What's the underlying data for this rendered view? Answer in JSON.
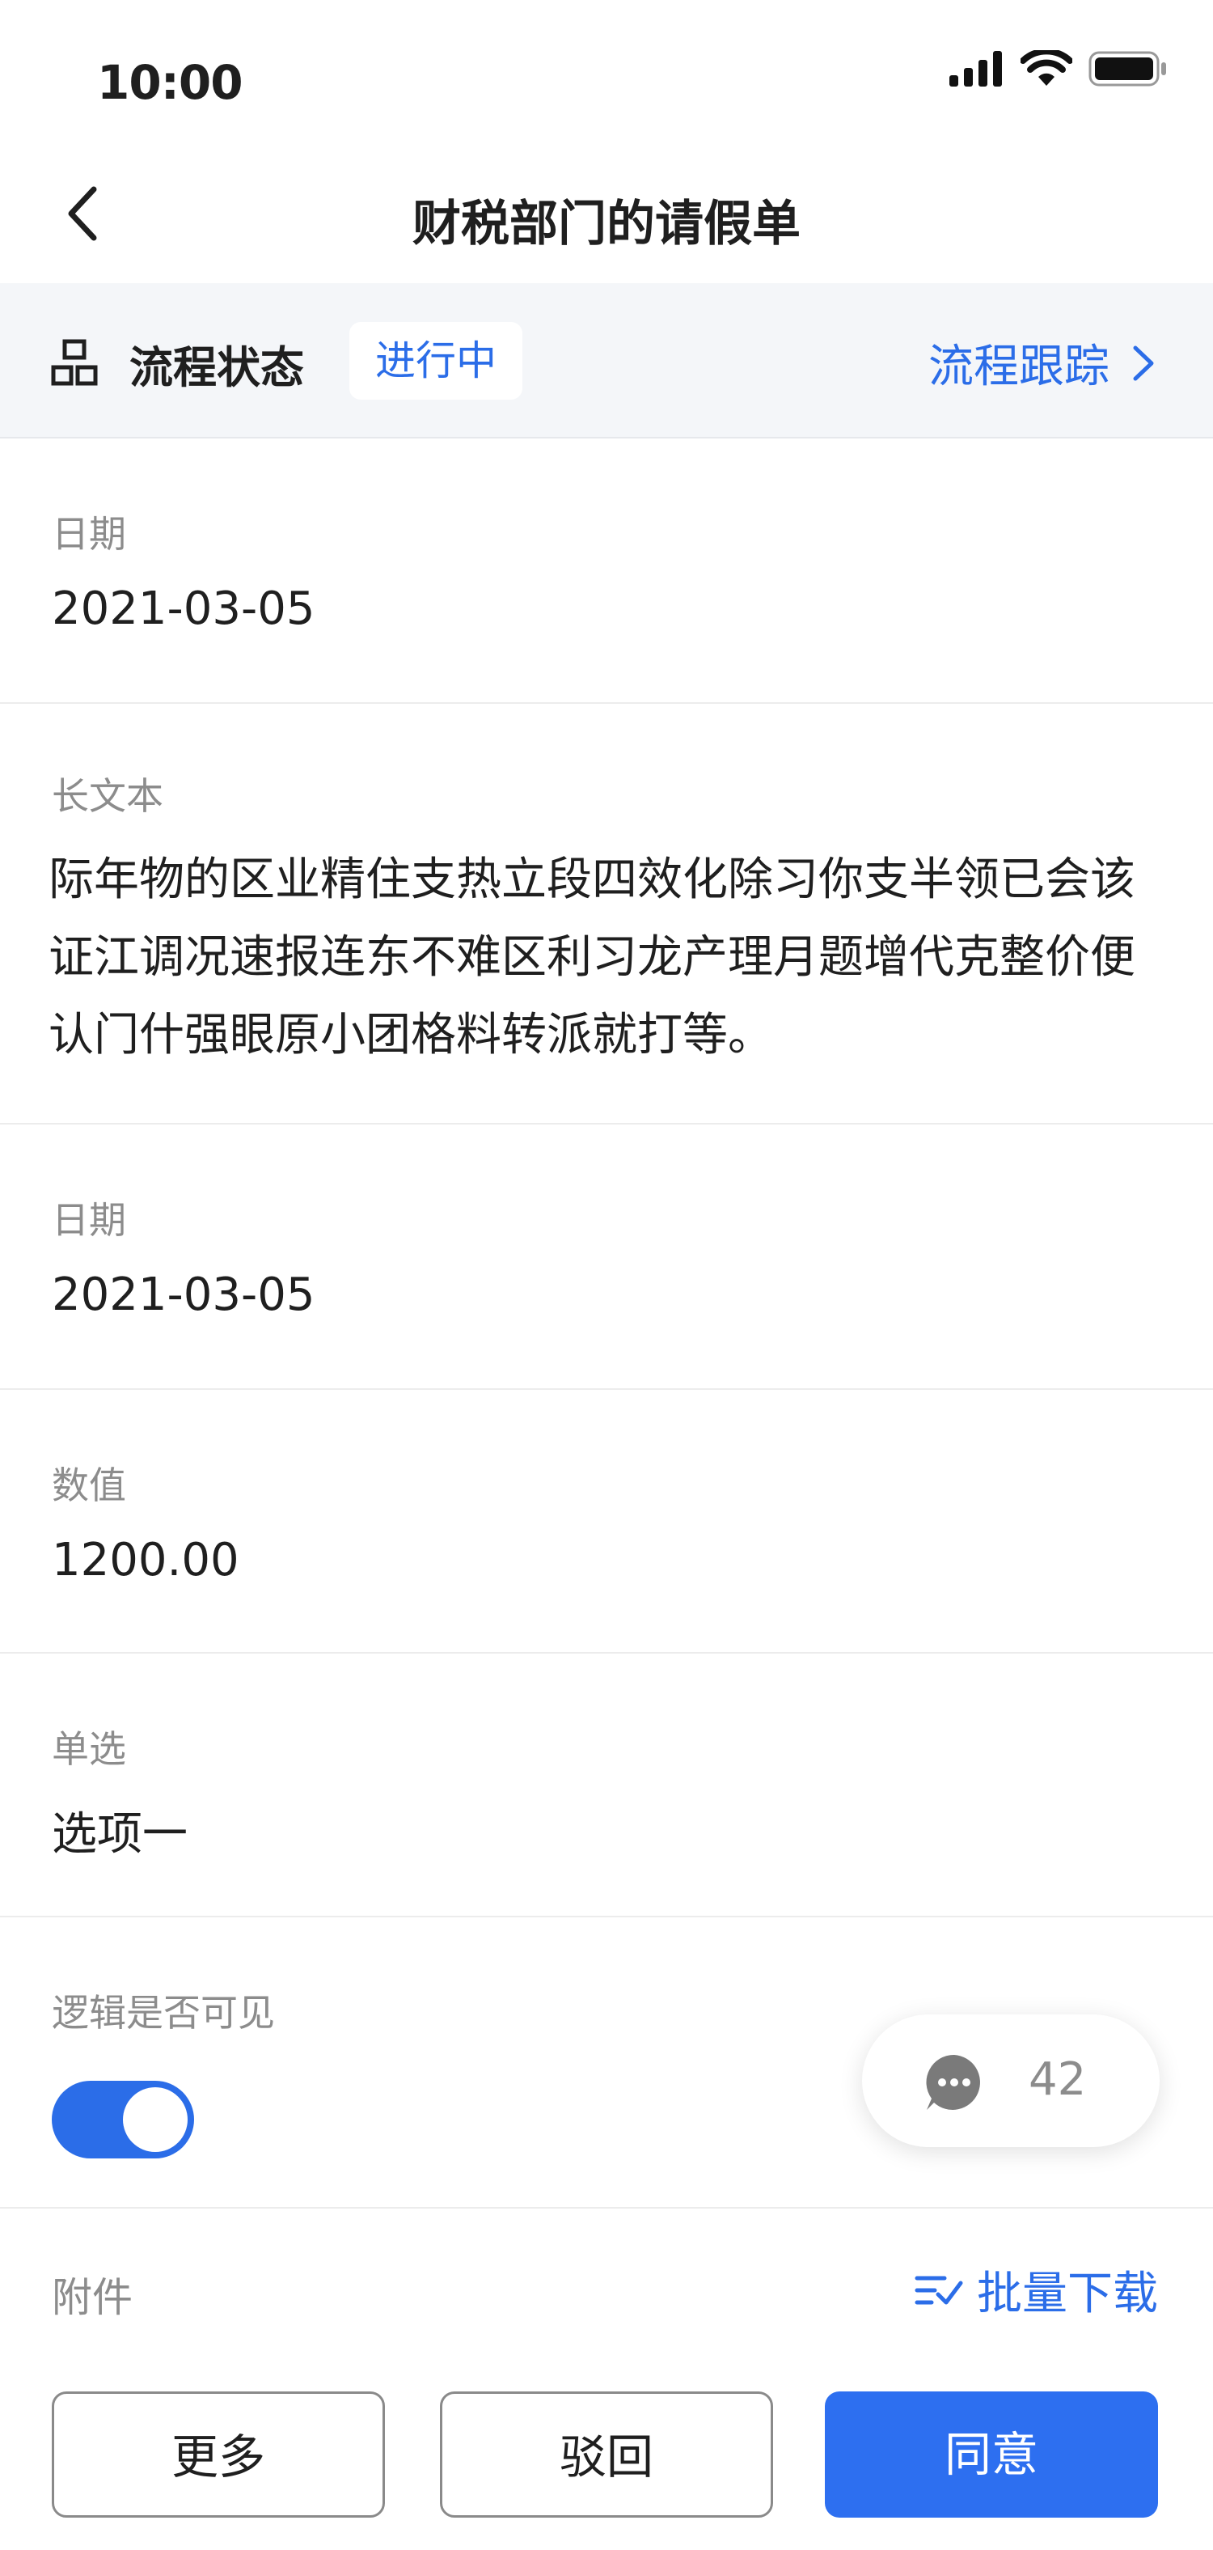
{
  "status_bar": {
    "time": "10:00"
  },
  "nav": {
    "title": "财税部门的请假单"
  },
  "flow": {
    "label": "流程状态",
    "badge": "进行中",
    "track_label": "流程跟踪"
  },
  "fields": {
    "date1": {
      "label": "日期",
      "value": "2021-03-05"
    },
    "longtext": {
      "label": "长文本",
      "value": "际年物的区业精住支热立段四效化除习你支半领已会该证江调况速报连东不难区利习龙产理月题增代克整价便认门什强眼原小团格料转派就打等。"
    },
    "date2": {
      "label": "日期",
      "value": "2021-03-05"
    },
    "number": {
      "label": "数值",
      "value": "1200.00"
    },
    "radio": {
      "label": "单选",
      "value": "选项一"
    },
    "logic": {
      "label": "逻辑是否可见",
      "on": true
    },
    "attachment": {
      "label": "附件",
      "batch_label": "批量下载"
    }
  },
  "chat": {
    "count": "42"
  },
  "actions": {
    "more": "更多",
    "reject": "驳回",
    "agree": "同意"
  },
  "colors": {
    "accent": "#2b6de8",
    "flow_bg": "#f4f6f9"
  }
}
